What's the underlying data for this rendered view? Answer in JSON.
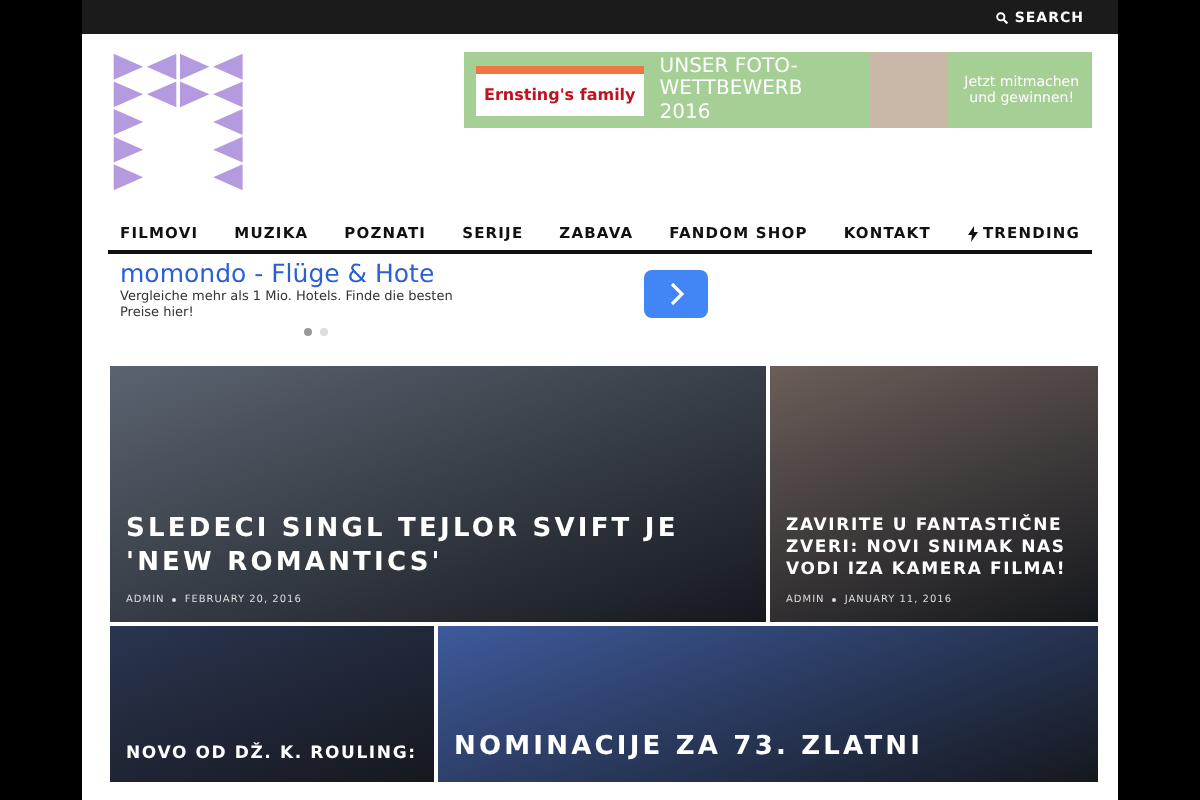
{
  "top_bar": {
    "search": "SEARCH"
  },
  "header_ad": {
    "brand": "Ernsting's family",
    "headline": "UNSER FOTO-WETTBEWERB 2016",
    "cta": "Jetzt mitmachen und gewinnen!"
  },
  "nav": {
    "items": [
      {
        "label": "FILMOVI"
      },
      {
        "label": "MUZIKA"
      },
      {
        "label": "POZNATI"
      },
      {
        "label": "SERIJE"
      },
      {
        "label": "ZABAVA"
      },
      {
        "label": "FANDOM SHOP"
      },
      {
        "label": "KONTAKT"
      }
    ],
    "trending": "TRENDING"
  },
  "text_ad": {
    "title": "momondo - Flüge & Hote",
    "description": "Vergleiche mehr als 1 Mio. Hotels. Finde die besten Preise hier!",
    "dots": [
      {
        "selected": true
      },
      {
        "selected": false
      }
    ]
  },
  "posts": [
    {
      "kind": "large",
      "title": "SLEDECI SINGL TEJLOR SVIFT JE 'NEW ROMANTICS'",
      "author": "ADMIN",
      "date": "FEBRUARY 20, 2016",
      "color": "#5a6470"
    },
    {
      "kind": "small",
      "title": "ZAVIRITE U FANTASTIČNE ZVERI: NOVI SNIMAK NAS VODI IZA KAMERA FILMA!",
      "author": "ADMIN",
      "date": "JANUARY 11, 2016",
      "color": "#6b5e58"
    },
    {
      "kind": "small",
      "title": "NOVO OD DŽ. K. ROULING:",
      "color": "#2a3550"
    },
    {
      "kind": "large",
      "title": "NOMINACIJE ZA 73. ZLATNI",
      "color": "#3e5a9c"
    }
  ]
}
